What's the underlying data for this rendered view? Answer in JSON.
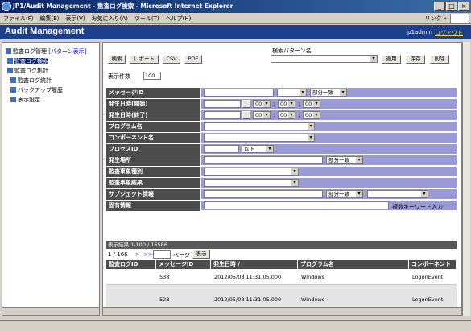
{
  "window": {
    "title": "JP1/Audit Management - 監査ログ検索 - Microsoft Internet Explorer",
    "min": "_",
    "max": "□",
    "close": "×"
  },
  "menubar": {
    "items": [
      "ファイル(F)",
      "編集(E)",
      "表示(V)",
      "お気に入り(A)",
      "ツール(T)",
      "ヘルプ(H)"
    ],
    "links_label": "リンク »"
  },
  "header": {
    "app_title": "Audit Management",
    "user": "jp1admin",
    "logout": "ログアウト"
  },
  "tree": {
    "root": "監査ログ管理",
    "root_link": "[パターン表示]",
    "items": [
      "監査ログ検索",
      "監査ログ集計",
      "監査ログ統計",
      "バックアップ履歴",
      "表示設定"
    ]
  },
  "toolbar": {
    "search": "検索",
    "report": "レポート",
    "csv": "CSV",
    "pdf": "PDF"
  },
  "pattern": {
    "label": "検索パターン名",
    "apply": "適用",
    "save": "保存",
    "delete": "削除"
  },
  "count": {
    "label": "表示件数",
    "value": "100"
  },
  "form": {
    "message_id": "メッセージID",
    "match_partial": "部分一致",
    "start_datetime": "発生日時(開始)",
    "end_datetime": "発生日時(終了)",
    "time_zero": "00",
    "colon": ":",
    "program_name": "プログラム名",
    "component_name": "コンポーネント名",
    "process_id": "プロセスID",
    "below": "以下",
    "location": "発生場所",
    "event_type": "監査事象種別",
    "event_result": "監査事象結果",
    "subject_info": "サブジェクト情報",
    "specific_info": "固有情報",
    "multi_keyword": "複数キーワード入力"
  },
  "results": {
    "summary": "表示結果 1-100 / 16586",
    "pager": "1 / 166",
    "next": ">",
    "last": ">>",
    "page_label": "ページ",
    "show": "表示",
    "columns": [
      "監査ログID",
      "メッセージID",
      "発生日時 ∕",
      "プログラム名",
      "コンポーネント"
    ],
    "rows": [
      [
        "",
        "538",
        "2012/05/08 11:31:05.000",
        "Windows",
        "LogonEvent"
      ],
      [
        "",
        "528",
        "2012/05/08 11:31:05.000",
        "Windows",
        "LogonEvent"
      ]
    ]
  }
}
